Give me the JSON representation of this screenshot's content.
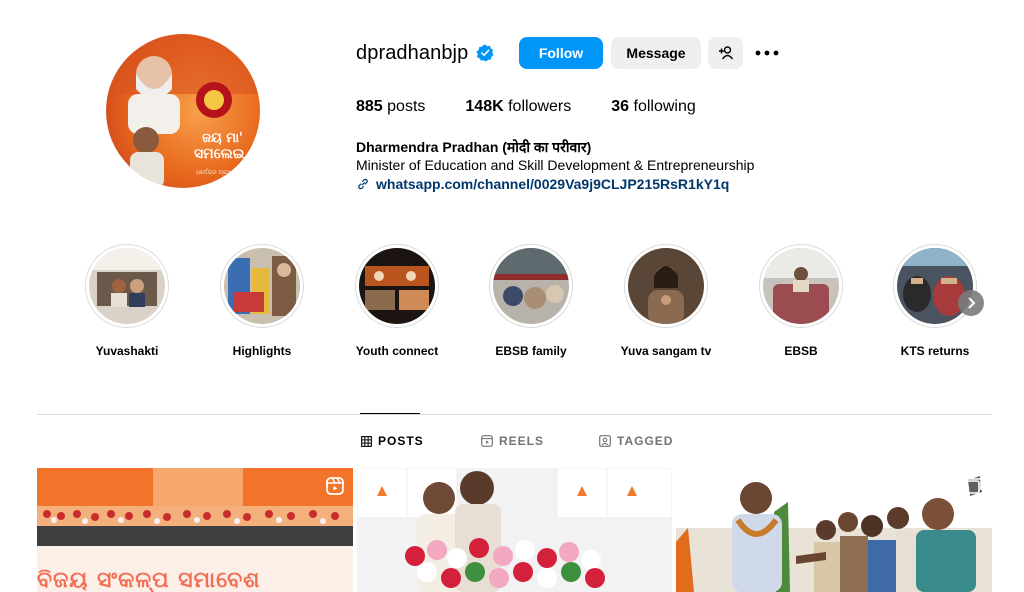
{
  "profile": {
    "username": "dpradhanbjp",
    "follow_label": "Follow",
    "message_label": "Message",
    "stats": {
      "posts_count": "885",
      "posts_label": "posts",
      "followers_count": "148K",
      "followers_label": "followers",
      "following_count": "36",
      "following_label": "following"
    },
    "bio": {
      "name": "Dharmendra Pradhan (मोदी का परीवार)",
      "description": "Minister of Education and Skill Development & Entrepreneurship",
      "link": "whatsapp.com/channel/0029Va9j9CLJP215RsR1kY1q"
    },
    "avatar_text": "ଜୟ ମା' ସମଲେଇ"
  },
  "highlights": [
    {
      "label": "Yuvashakti"
    },
    {
      "label": "Highlights"
    },
    {
      "label": "Youth connect"
    },
    {
      "label": "EBSB family"
    },
    {
      "label": "Yuva sangam tv"
    },
    {
      "label": "EBSB"
    },
    {
      "label": "KTS returns"
    }
  ],
  "tabs": {
    "posts": "POSTS",
    "reels": "REELS",
    "tagged": "TAGGED"
  },
  "posts": {
    "post1_text": "ବିଜୟ ସଂକଳ୍ପ ସମାବେଶ"
  },
  "colors": {
    "accent": "#0095f6",
    "link": "#00376b",
    "secondary_button": "#efefef",
    "divider": "#dbdbdb",
    "muted_text": "#737373",
    "verified": "#0095f6"
  },
  "icons": [
    "verified-badge-icon",
    "add-user-icon",
    "more-options-icon",
    "link-icon",
    "chevron-right-icon",
    "grid-icon",
    "reels-icon",
    "tagged-icon",
    "reel-badge-icon"
  ]
}
